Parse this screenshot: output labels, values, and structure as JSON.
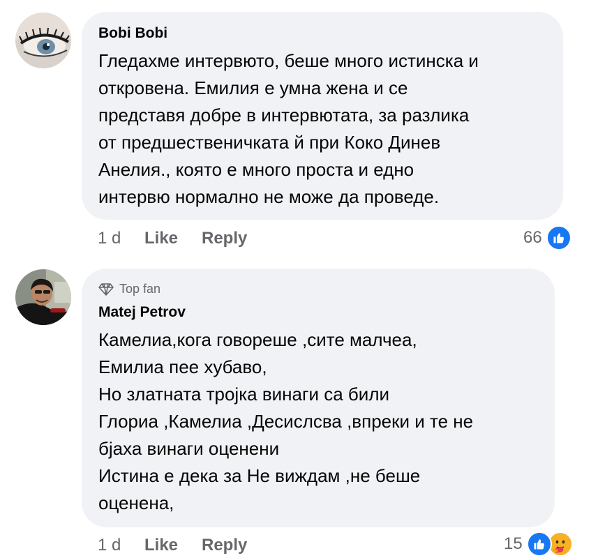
{
  "comments": [
    {
      "author": "Bobi Bobi",
      "badge": "",
      "lines": [
        "Гледахме интервюто, беше много истинска и",
        "откровена. Емилия е умна жена и се",
        "представя добре в интервютата, за разлика",
        "от предшественичката й при Коко Динев",
        "Анелия., която е много проста и едно",
        "интервю нормално не може да проведе."
      ],
      "time": "1 d",
      "like_label": "Like",
      "reply_label": "Reply",
      "reaction_count": "66",
      "reactions": [
        "like-reaction-icon"
      ]
    },
    {
      "author": "Matej Petrov",
      "badge": "Top fan",
      "lines": [
        "Камелиа,кога говореше ,сите малчеа,",
        "Емилиа пее хубаво,",
        "Но златната тројка винаги са били",
        "Глориа ,Камелиа ,Десислсва ,впреки и те не",
        "бјаха винаги оценени",
        "Истина е дека за Не виждам ,не беше",
        "оценена,"
      ],
      "time": "1 d",
      "like_label": "Like",
      "reply_label": "Reply",
      "reaction_count": "15",
      "reactions": [
        "like-reaction-icon",
        "care-reaction-icon"
      ]
    }
  ],
  "colors": {
    "bubble_bg": "#f0f2f5",
    "meta_text": "#65676b",
    "like_blue": "#1877f2",
    "care_yellow": "#f7b125"
  }
}
